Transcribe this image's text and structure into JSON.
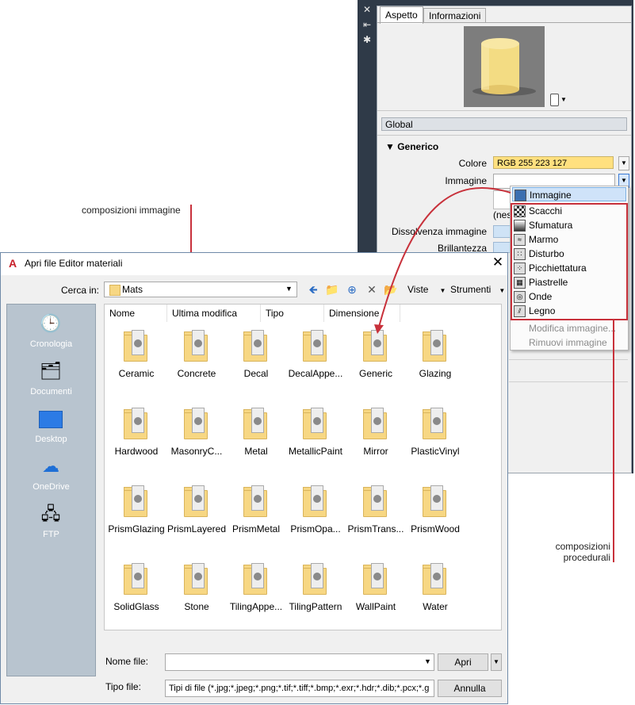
{
  "material_panel": {
    "tabs": [
      "Aspetto",
      "Informazioni"
    ],
    "global_label": "Global",
    "section_title": "Generico",
    "properties": {
      "colore_label": "Colore",
      "colore_value": "RGB 255 223 127",
      "immagine_label": "Immagine",
      "nessuna_partial": "(nes",
      "dissolvenza_label": "Dissolvenza immagine",
      "brillantezza_label": "Brillantezza"
    },
    "preview_color": "#f3dc83"
  },
  "image_menu": {
    "items": [
      {
        "label": "Immagine",
        "icon": "image-icon",
        "state": "highlighted"
      },
      {
        "label": "Scacchi",
        "icon": "checker-icon",
        "state": "normal"
      },
      {
        "label": "Sfumatura",
        "icon": "gradient-icon",
        "state": "normal"
      },
      {
        "label": "Marmo",
        "icon": "marble-icon",
        "state": "normal"
      },
      {
        "label": "Disturbo",
        "icon": "noise-icon",
        "state": "normal"
      },
      {
        "label": "Picchiettatura",
        "icon": "speckle-icon",
        "state": "normal"
      },
      {
        "label": "Piastrelle",
        "icon": "tiles-icon",
        "state": "normal"
      },
      {
        "label": "Onde",
        "icon": "waves-icon",
        "state": "normal"
      },
      {
        "label": "Legno",
        "icon": "wood-icon",
        "state": "normal"
      },
      {
        "label": "Modifica immagine...",
        "icon": "",
        "state": "disabled"
      },
      {
        "label": "Rimuovi immagine",
        "icon": "",
        "state": "disabled"
      }
    ]
  },
  "dialog": {
    "title": "Apri file Editor materiali",
    "look_in_label": "Cerca in:",
    "look_in_value": "Mats",
    "views_label": "Viste",
    "tools_label": "Strumenti",
    "places": [
      "Cronologia",
      "Documenti",
      "Desktop",
      "OneDrive",
      "FTP"
    ],
    "columns": [
      "Nome",
      "Ultima modifica",
      "Tipo",
      "Dimensione"
    ],
    "files": [
      "Ceramic",
      "Concrete",
      "Decal",
      "DecalAppe...",
      "Generic",
      "Glazing",
      "Hardwood",
      "MasonryC...",
      "Metal",
      "MetallicPaint",
      "Mirror",
      "PlasticVinyl",
      "PrismGlazing",
      "PrismLayered",
      "PrismMetal",
      "PrismOpa...",
      "PrismTrans...",
      "PrismWood",
      "SolidGlass",
      "Stone",
      "TilingAppe...",
      "TilingPattern",
      "WallPaint",
      "Water"
    ],
    "file_name_label": "Nome file:",
    "file_name_value": "",
    "file_type_label": "Tipo file:",
    "file_type_value": "Tipi di file  (*.jpg;*.jpeg;*.png;*.tif;*.tiff;*.bmp;*.exr;*.hdr;*.dib;*.pcx;*.g",
    "open_label": "Apri",
    "cancel_label": "Annulla"
  },
  "callouts": {
    "image_compositions": "composizioni immagine",
    "procedural_line1": "composizioni",
    "procedural_line2": "procedurali"
  },
  "colors": {
    "accent_red": "#c8313b",
    "panel_dark": "#2f3a48",
    "folder_yellow": "#f7d783",
    "places_bg": "#b8c4cf"
  }
}
